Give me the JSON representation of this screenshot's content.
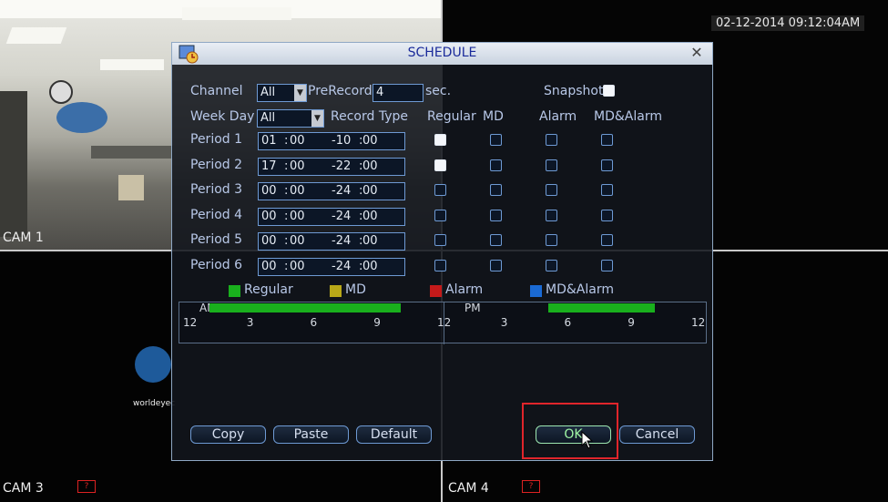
{
  "timestamp": "02-12-2014 09:12:04AM",
  "cameras": {
    "cam1": "CAM 1",
    "cam3": "CAM 3",
    "cam4": "CAM 4",
    "cam3_logo_text": "worldeyec"
  },
  "dialog": {
    "title": "SCHEDULE",
    "channel_label": "Channel",
    "channel_value": "All",
    "prerecord_label": "PreRecord",
    "prerecord_value": "4",
    "prerecord_unit": "sec.",
    "snapshot_label": "Snapshot",
    "weekday_label": "Week Day",
    "weekday_value": "All",
    "record_type_label": "Record Type",
    "columns": [
      "Regular",
      "MD",
      "Alarm",
      "MD&Alarm"
    ],
    "periods": [
      {
        "label": "Period 1",
        "start_h": "01",
        "start_m": "00",
        "end_h": "-10",
        "end_m": "00",
        "regular": true
      },
      {
        "label": "Period 2",
        "start_h": "17",
        "start_m": "00",
        "end_h": "-22",
        "end_m": "00",
        "regular": true
      },
      {
        "label": "Period 3",
        "start_h": "00",
        "start_m": "00",
        "end_h": "-24",
        "end_m": "00",
        "regular": false
      },
      {
        "label": "Period 4",
        "start_h": "00",
        "start_m": "00",
        "end_h": "-24",
        "end_m": "00",
        "regular": false
      },
      {
        "label": "Period 5",
        "start_h": "00",
        "start_m": "00",
        "end_h": "-24",
        "end_m": "00",
        "regular": false
      },
      {
        "label": "Period 6",
        "start_h": "00",
        "start_m": "00",
        "end_h": "-24",
        "end_m": "00",
        "regular": false
      }
    ],
    "legend": [
      {
        "label": "Regular",
        "color": "#19b01d"
      },
      {
        "label": "MD",
        "color": "#b8a818"
      },
      {
        "label": "Alarm",
        "color": "#c41a1a"
      },
      {
        "label": "MD&Alarm",
        "color": "#1a6ad4"
      }
    ],
    "timeline": {
      "am_label": "AM",
      "pm_label": "PM",
      "ticks": [
        "12",
        "3",
        "6",
        "9",
        "12",
        "3",
        "6",
        "9",
        "12"
      ],
      "regular_segments_hours": [
        [
          1,
          10
        ],
        [
          17,
          22
        ]
      ]
    },
    "buttons": {
      "copy": "Copy",
      "paste": "Paste",
      "default": "Default",
      "ok": "OK",
      "cancel": "Cancel"
    }
  }
}
